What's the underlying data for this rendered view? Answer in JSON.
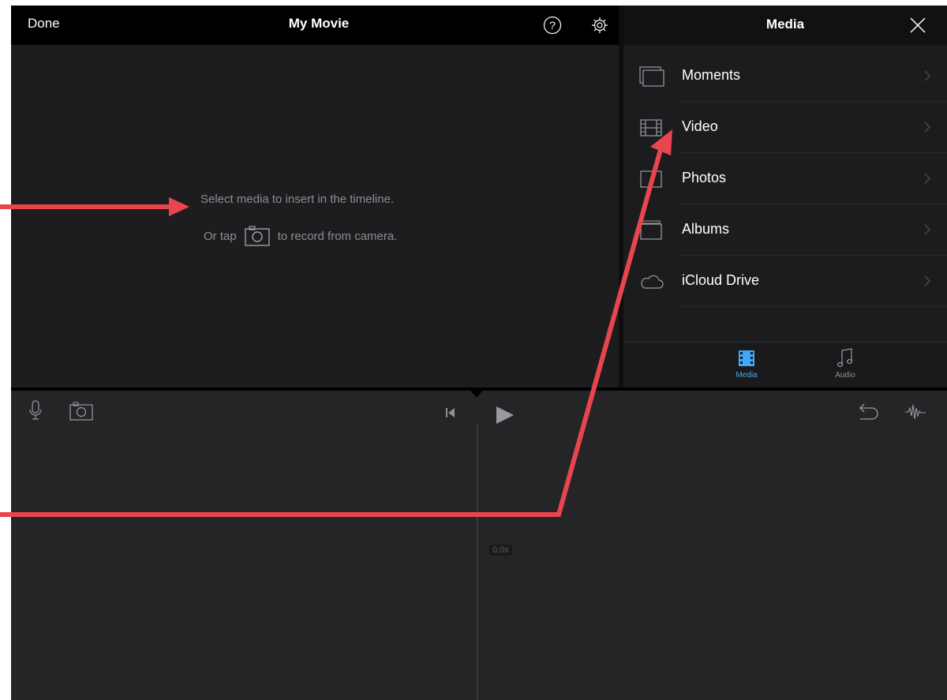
{
  "top_bar": {
    "done_label": "Done",
    "title": "My Movie",
    "help_icon": "question-circle-icon",
    "settings_icon": "gear-icon"
  },
  "viewer": {
    "message_line1": "Select media to insert in the timeline.",
    "message_line2_prefix": "Or tap",
    "message_line2_suffix": "to record from camera.",
    "camera_icon": "camera-icon"
  },
  "media_panel": {
    "title": "Media",
    "close_icon": "close-icon",
    "items": [
      {
        "label": "Moments",
        "icon": "moments-icon"
      },
      {
        "label": "Video",
        "icon": "film-icon"
      },
      {
        "label": "Photos",
        "icon": "photos-icon"
      },
      {
        "label": "Albums",
        "icon": "albums-icon"
      },
      {
        "label": "iCloud Drive",
        "icon": "cloud-icon"
      }
    ],
    "tabs": [
      {
        "label": "Media",
        "icon": "film-strip-icon",
        "active": true
      },
      {
        "label": "Audio",
        "icon": "music-note-icon",
        "active": false
      }
    ]
  },
  "timeline": {
    "time_label": "0,0s",
    "mic_icon": "microphone-icon",
    "camera_icon": "camera-icon",
    "rewind_icon": "skip-to-start-icon",
    "play_icon": "play-icon",
    "undo_icon": "undo-icon",
    "audio_wave_icon": "waveform-icon"
  },
  "colors": {
    "accent": "#3fa9f5",
    "annotation_arrow": "#e8454f",
    "background": "#232325",
    "top_bar": "#000000"
  }
}
